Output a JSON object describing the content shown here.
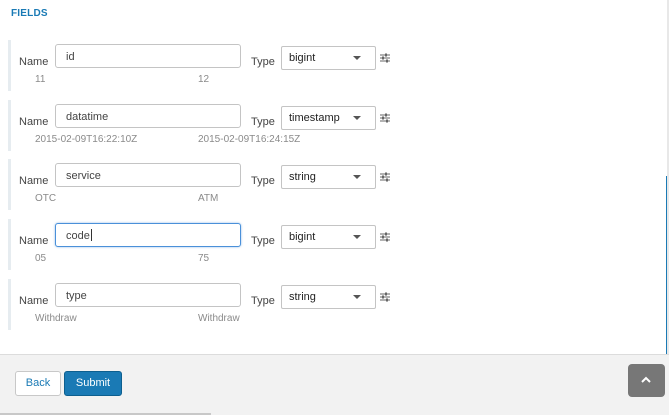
{
  "section": {
    "title": "FIELDS"
  },
  "labels": {
    "name": "Name",
    "type": "Type"
  },
  "fields": [
    {
      "name": "id",
      "type": "bigint",
      "samples": [
        "11",
        "12"
      ]
    },
    {
      "name": "datatime",
      "type": "timestamp",
      "samples": [
        "2015-02-09T16:22:10Z",
        "2015-02-09T16:24:15Z"
      ]
    },
    {
      "name": "service",
      "type": "string",
      "samples": [
        "OTC",
        "ATM"
      ]
    },
    {
      "name": "code",
      "type": "bigint",
      "samples": [
        "05",
        "75"
      ]
    },
    {
      "name": "type",
      "type": "string",
      "samples": [
        "Withdraw",
        "Withdraw"
      ]
    }
  ],
  "focused_field": "code",
  "footer": {
    "back_label": "Back",
    "submit_label": "Submit"
  },
  "icons": {
    "settings": "sliders-icon",
    "dropdown": "chevron-down-icon",
    "scroll_top": "chevron-up-icon"
  },
  "colors": {
    "accent": "#1a7ab5",
    "focus_border": "#4a90d9",
    "scroll_button": "#777777"
  }
}
